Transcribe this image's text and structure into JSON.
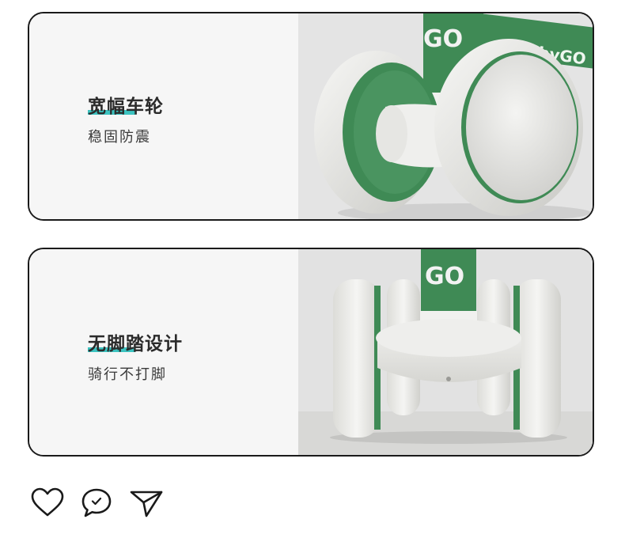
{
  "cards": [
    {
      "title": "宽幅车轮",
      "subtitle": "稳固防震",
      "brand_text": "BabyGO",
      "logo_text": "GO"
    },
    {
      "title": "无脚踏设计",
      "subtitle": "骑行不打脚",
      "logo_text": "GO"
    }
  ],
  "actions": [
    "heart-icon",
    "comment-icon",
    "send-icon"
  ],
  "colors": {
    "accent_underline": "#3cc3c0",
    "bike_green": "#3f8a55",
    "wheel_white": "#ebebe7",
    "border": "#1a1a1a"
  }
}
